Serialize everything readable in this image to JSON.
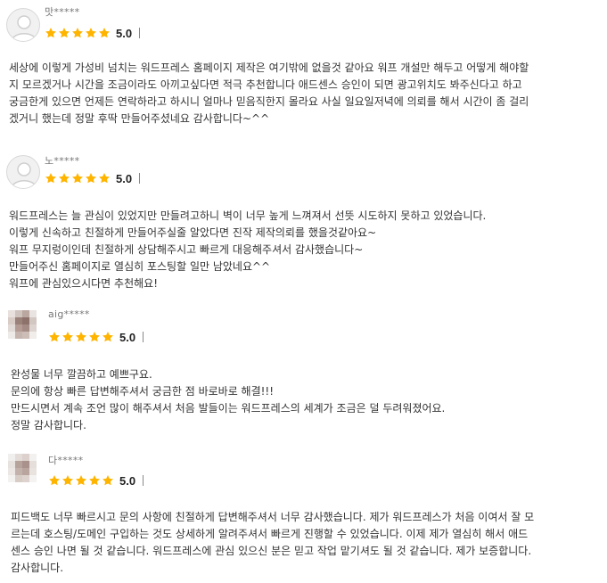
{
  "colors": {
    "star": "#FFB400",
    "text": "#333333",
    "username": "#777777"
  },
  "reviews": [
    {
      "username": "맛*****",
      "avatar": "default-avatar",
      "score": "5.0",
      "lines": [
        "세상에 이렇게 가성비 넘치는 워드프레스 홈페이지 제작은 여기밖에 없을것 같아요 워프 개설만 해두고 어떻게 해야할",
        "지 모르겠거나 시간을 조금이라도 아끼고싶다면 적극 추천합니다 애드센스 승인이 되면 광고위치도 봐주신다고 하고",
        "궁금한게 있으면 언제든 연락하라고 하시니 얼마나 믿음직한지 몰라요 사실 일요일저녁에 의뢰를 해서 시간이 좀 걸리",
        "겠거니 했는데 정말 후딱 만들어주셨네요 감사합니다~^^"
      ]
    },
    {
      "username": "노*****",
      "avatar": "default-avatar",
      "score": "5.0",
      "lines": [
        "워드프레스는 늘 관심이 있었지만 만들려고하니 벽이 너무 높게 느껴져서 선뜻 시도하지 못하고 있었습니다.",
        "이렇게 신속하고 친절하게 만들어주실줄 알았다면 진작 제작의뢰를 했을것같아요~",
        "워프 무지렁이인데 친절하게 상담해주시고 빠르게 대응해주셔서 감사했습니다~",
        "만들어주신 홈페이지로 열심히 포스팅할 일만 남았네요^^",
        "워프에 관심있으시다면 추천해요!"
      ]
    },
    {
      "username": "aig*****",
      "avatar": "blurred-photo",
      "score": "5.0",
      "lines": [
        "완성물 너무 깔끔하고 예쁘구요.",
        "문의에 항상 빠른 답변해주셔서 궁금한 점 바로바로 해결!!!",
        "만드시면서 계속 조언 많이 해주셔서 처음 발들이는 워드프레스의 세계가 조금은 덜 두려워졌어요.",
        "정말 감사합니다."
      ]
    },
    {
      "username": "다*****",
      "avatar": "blurred-photo",
      "score": "5.0",
      "lines": [
        "피드백도 너무 빠르시고 문의 사항에 친절하게 답변해주셔서 너무 감사했습니다. 제가 워드프레스가 처음 이여서 잘 모",
        "르는데 호스팅/도메인 구입하는 것도 상세하게 알려주셔서 빠르게  진행할 수 있었습니다. 이제 제가 열심히 해서 애드",
        "센스  승인 나면 될 것 같습니다.  워드프레스에  관심 있으신 분은 믿고 작업 맡기셔도 될 것 같습니다. 제가 보증합니다.",
        "감사합니다."
      ]
    }
  ]
}
